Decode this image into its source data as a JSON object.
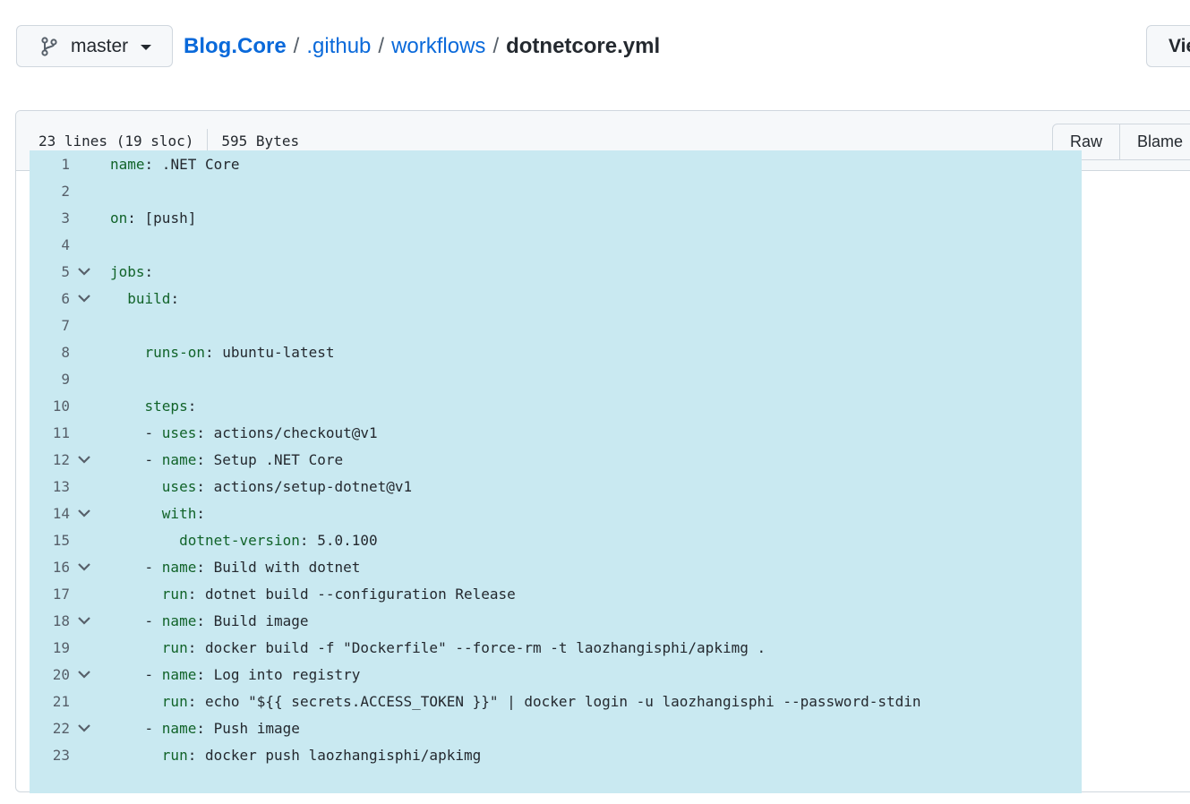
{
  "branch": {
    "label": "master",
    "icon": "git-branch-icon"
  },
  "breadcrumb": {
    "repo": "Blog.Core",
    "sep1": "/",
    "folder1": ".github",
    "sep2": "/",
    "folder2": "workflows",
    "sep3": "/",
    "file": "dotnetcore.yml"
  },
  "view_button": "Vie",
  "file_info": {
    "lines": "23 lines (19 sloc)",
    "size": "595 Bytes"
  },
  "buttons": {
    "raw": "Raw",
    "blame": "Blame"
  },
  "colors": {
    "selection": "#c9e9f1",
    "key": "#116329",
    "link": "#0969da"
  },
  "code_lines": [
    {
      "num": "1",
      "fold": false,
      "indent": "",
      "key": "name",
      "rest": " .NET Core"
    },
    {
      "num": "2",
      "fold": false,
      "indent": "",
      "key": "",
      "rest": ""
    },
    {
      "num": "3",
      "fold": false,
      "indent": "",
      "key": "on",
      "rest": " [push]"
    },
    {
      "num": "4",
      "fold": false,
      "indent": "",
      "key": "",
      "rest": ""
    },
    {
      "num": "5",
      "fold": true,
      "indent": "",
      "key": "jobs",
      "rest": ""
    },
    {
      "num": "6",
      "fold": true,
      "indent": "  ",
      "key": "build",
      "rest": ""
    },
    {
      "num": "7",
      "fold": false,
      "indent": "",
      "key": "",
      "rest": ""
    },
    {
      "num": "8",
      "fold": false,
      "indent": "    ",
      "key": "runs-on",
      "rest": " ubuntu-latest"
    },
    {
      "num": "9",
      "fold": false,
      "indent": "",
      "key": "",
      "rest": ""
    },
    {
      "num": "10",
      "fold": false,
      "indent": "    ",
      "key": "steps",
      "rest": ""
    },
    {
      "num": "11",
      "fold": false,
      "indent": "    - ",
      "key": "uses",
      "rest": " actions/checkout@v1"
    },
    {
      "num": "12",
      "fold": true,
      "indent": "    - ",
      "key": "name",
      "rest": " Setup .NET Core"
    },
    {
      "num": "13",
      "fold": false,
      "indent": "      ",
      "key": "uses",
      "rest": " actions/setup-dotnet@v1"
    },
    {
      "num": "14",
      "fold": true,
      "indent": "      ",
      "key": "with",
      "rest": ""
    },
    {
      "num": "15",
      "fold": false,
      "indent": "        ",
      "key": "dotnet-version",
      "rest": " 5.0.100"
    },
    {
      "num": "16",
      "fold": true,
      "indent": "    - ",
      "key": "name",
      "rest": " Build with dotnet"
    },
    {
      "num": "17",
      "fold": false,
      "indent": "      ",
      "key": "run",
      "rest": " dotnet build --configuration Release"
    },
    {
      "num": "18",
      "fold": true,
      "indent": "    - ",
      "key": "name",
      "rest": " Build image"
    },
    {
      "num": "19",
      "fold": false,
      "indent": "      ",
      "key": "run",
      "rest": " docker build -f \"Dockerfile\" --force-rm -t laozhangisphi/apkimg ."
    },
    {
      "num": "20",
      "fold": true,
      "indent": "    - ",
      "key": "name",
      "rest": " Log into registry"
    },
    {
      "num": "21",
      "fold": false,
      "indent": "      ",
      "key": "run",
      "rest": " echo \"${{ secrets.ACCESS_TOKEN }}\" | docker login -u laozhangisphi --password-stdin"
    },
    {
      "num": "22",
      "fold": true,
      "indent": "    - ",
      "key": "name",
      "rest": " Push image"
    },
    {
      "num": "23",
      "fold": false,
      "indent": "      ",
      "key": "run",
      "rest": " docker push laozhangisphi/apkimg"
    }
  ]
}
